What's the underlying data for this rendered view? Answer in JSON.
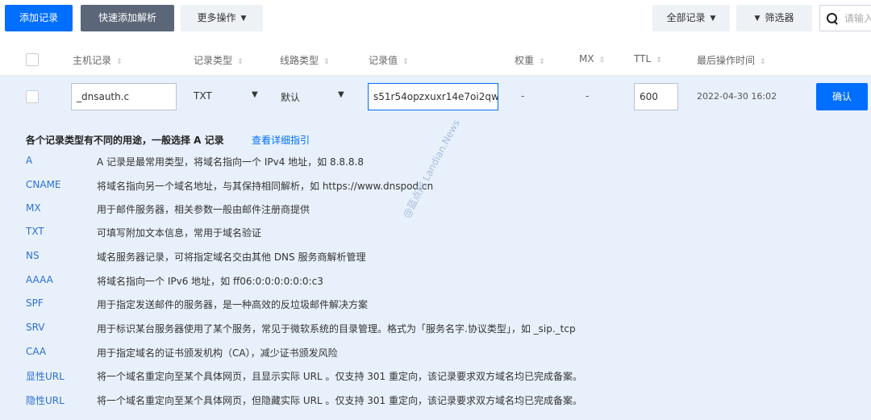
{
  "toolbar": {
    "add_record": "添加记录",
    "quick_add": "快速添加解析",
    "more_actions": "更多操作",
    "all_records": "全部记录",
    "filter": "筛选器",
    "search_placeholder": "请输入"
  },
  "table": {
    "columns": [
      "主机记录",
      "记录类型",
      "线路类型",
      "记录值",
      "权重",
      "MX",
      "TTL",
      "最后操作时间"
    ]
  },
  "edit_row": {
    "host": "_dnsauth.c",
    "record_type": "TXT",
    "line_type": "默认",
    "record_value": "s51r54opzxuxr14e7oi2qw",
    "weight": "-",
    "mx": "-",
    "ttl": "600",
    "last_modified": "2022-04-30 16:02",
    "confirm": "确认"
  },
  "help": {
    "title": "各个记录类型有不同的用途，一般选择 A 记录",
    "link": "查看详细指引",
    "items": [
      {
        "type": "A",
        "desc": "A 记录是最常用类型，将域名指向一个 IPv4 地址，如 8.8.8.8"
      },
      {
        "type": "CNAME",
        "desc": "将域名指向另一个域名地址，与其保持相同解析，如 https://www.dnspod.cn"
      },
      {
        "type": "MX",
        "desc": "用于邮件服务器，相关参数一般由邮件注册商提供"
      },
      {
        "type": "TXT",
        "desc": "可填写附加文本信息，常用于域名验证"
      },
      {
        "type": "NS",
        "desc": "域名服务器记录，可将指定域名交由其他 DNS 服务商解析管理"
      },
      {
        "type": "AAAA",
        "desc": "将域名指向一个 IPv6 地址，如 ff06:0:0:0:0:0:0:c3"
      },
      {
        "type": "SPF",
        "desc": "用于指定发送邮件的服务器，是一种高效的反垃圾邮件解决方案"
      },
      {
        "type": "SRV",
        "desc": "用于标识某台服务器使用了某个服务，常见于微软系统的目录管理。格式为「服务名字.协议类型」，如 _sip._tcp"
      },
      {
        "type": "CAA",
        "desc": "用于指定域名的证书颁发机构（CA），减少证书颁发风险"
      },
      {
        "type": "显性URL",
        "desc": "将一个域名重定向至某个具体网页，且显示实际 URL 。仅支持 301 重定向，该记录要求双方域名均已完成备案。"
      },
      {
        "type": "隐性URL",
        "desc": "将一个域名重定向至某个具体网页，但隐藏实际 URL 。仅支持 301 重定向，该记录要求双方域名均已完成备案。"
      }
    ]
  },
  "watermark": "@蓝点网 Landian.News"
}
